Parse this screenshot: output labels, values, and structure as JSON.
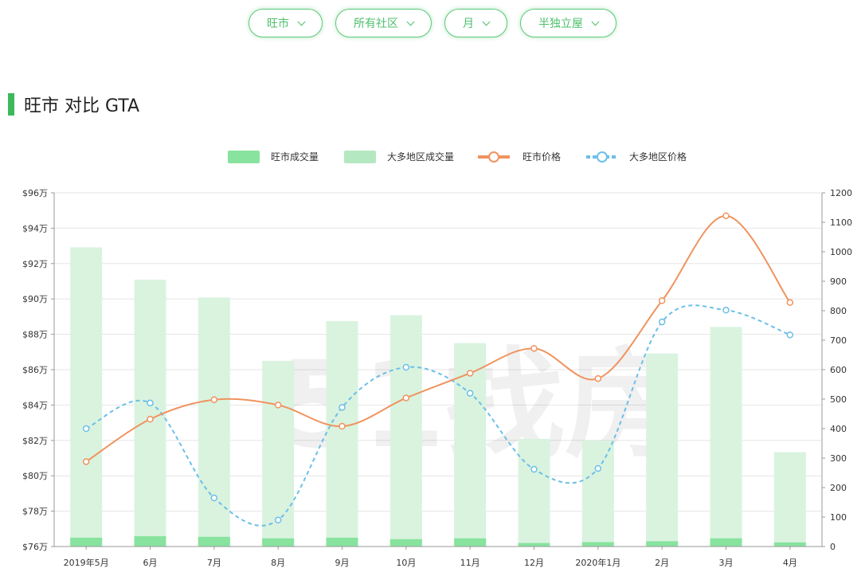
{
  "filters": [
    {
      "label": "旺市"
    },
    {
      "label": "所有社区"
    },
    {
      "label": "月"
    },
    {
      "label": "半独立屋"
    }
  ],
  "heading": "旺市 对比 GTA",
  "watermark": "51找房",
  "colors": {
    "accent": "#3db85a",
    "local_volume": "#87e39d",
    "gta_volume": "#d9f3df",
    "local_price": "#f0935f",
    "gta_price": "#6cbfe8"
  },
  "chart_data": {
    "type": "bar",
    "categories": [
      "2019年5月",
      "6月",
      "7月",
      "8月",
      "9月",
      "10月",
      "11月",
      "12月",
      "2020年1月",
      "2月",
      "3月",
      "4月"
    ],
    "legend": [
      "旺市成交量",
      "大多地区成交量",
      "旺市价格",
      "大多地区价格"
    ],
    "legend_position": "top-center",
    "grid": true,
    "y_left": {
      "min": 76,
      "max": 96,
      "step": 2,
      "prefix": "$",
      "suffix": "万"
    },
    "y_right": {
      "min": 0,
      "max": 1200,
      "step": 100
    },
    "series": [
      {
        "name": "旺市成交量",
        "type": "bar",
        "axis": "right",
        "values": [
          30,
          35,
          33,
          28,
          30,
          25,
          28,
          12,
          15,
          18,
          28,
          14
        ]
      },
      {
        "name": "大多地区成交量",
        "type": "bar",
        "axis": "right",
        "values": [
          1015,
          905,
          845,
          630,
          765,
          785,
          690,
          365,
          360,
          655,
          745,
          320
        ]
      },
      {
        "name": "旺市价格",
        "type": "line",
        "axis": "left",
        "values": [
          80.8,
          83.2,
          84.3,
          84.0,
          82.8,
          84.4,
          85.8,
          87.2,
          85.5,
          89.9,
          94.7,
          89.8
        ]
      },
      {
        "name": "大多地区价格",
        "type": "line",
        "axis": "right",
        "dashed": true,
        "values": [
          400,
          487,
          165,
          90,
          472,
          608,
          520,
          262,
          265,
          762,
          802,
          718
        ]
      }
    ]
  }
}
